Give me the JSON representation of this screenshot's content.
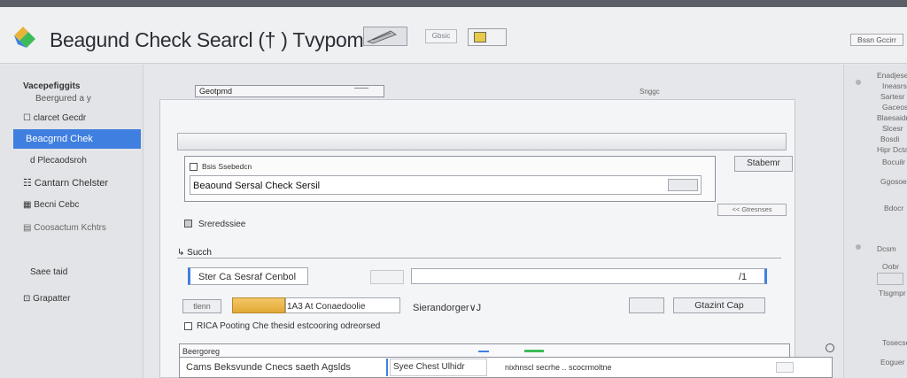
{
  "app": {
    "title": "Beagund Check Searcl († ) Tvypom"
  },
  "header": {
    "small_button": "Gbsic",
    "right_button": "Bssn Gccirr"
  },
  "sidebar": {
    "heading": "Vacepefiggits",
    "subheading": "Beergured a y ",
    "items": [
      {
        "label": "clarcet Gecdr"
      },
      {
        "label": "Beacgrnd Chek"
      },
      {
        "label": "Plecaodsroh"
      },
      {
        "label": "Cantarn Chelster"
      },
      {
        "label": "Becni Cebc"
      },
      {
        "label": "Coosactum Kchtrs"
      },
      {
        "label": "Saee taid"
      },
      {
        "label": "Grapatter"
      }
    ]
  },
  "main": {
    "top_tab": "Geotpmd",
    "top_tab_right": "Snggc",
    "box_label": "Bsis Ssebedcn",
    "box_value": "Beaound Sersal Check Sersil",
    "box_button": "Stabemr",
    "small_link": "<< Gtresnses",
    "option_label": "Sreredssiee",
    "search_label": "Succh",
    "search_value": "Ster Ca Sesraf Cenbol",
    "search_input_end": "/1",
    "mini_button": "tlenn",
    "yellow_label": "1A3 At Conaedoolie",
    "select_label": "Sierandorger∨J",
    "select_button": "Gtazint Cap",
    "checkbox_label": "RICA Pooting Che thesid estcooring odreorsed",
    "results_heading": "Beergoreg",
    "results_row": {
      "col1": "Cams Beksvunde Cnecs saeth Agslds",
      "col2": "Syee Chest Ulhidr",
      "col3": "nixhnscl secrhe .. scocrmoltne"
    }
  },
  "right_panel": {
    "items": [
      "Enadjeseas",
      "Ineasrs",
      "Sartesr",
      "Gaceosr",
      "Blaesaidr",
      "Slcesr",
      "Bosdi",
      "Hipr Dctars",
      "Bocuilr",
      "Ggosoeer",
      "Bdocr",
      "Dcsm",
      "Oobr",
      "Tlsgmpr",
      "Tosecseer",
      "Eoguer"
    ]
  },
  "colors": {
    "accent": "#3f7fe0",
    "highlight": "#e9b84a",
    "success": "#3dbb57"
  }
}
